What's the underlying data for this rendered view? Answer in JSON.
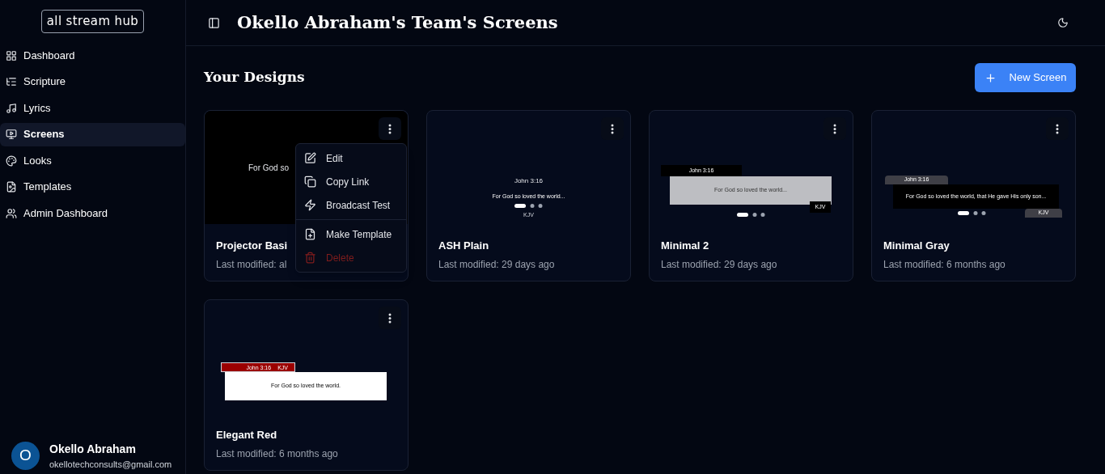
{
  "sidebar": {
    "logo": "all stream hub",
    "items": [
      {
        "label": "Dashboard",
        "selected": false
      },
      {
        "label": "Scripture",
        "selected": false
      },
      {
        "label": "Lyrics",
        "selected": false
      },
      {
        "label": "Screens",
        "selected": true
      },
      {
        "label": "Looks",
        "selected": false
      },
      {
        "label": "Templates",
        "selected": false
      },
      {
        "label": "Admin Dashboard",
        "selected": false
      }
    ],
    "user": {
      "initial": "O",
      "name": "Okello Abraham",
      "email": "okellotechconsults@gmail.com"
    }
  },
  "header": {
    "title": "Okello Abraham's Team's Screens"
  },
  "section": {
    "title": "Your Designs",
    "new_button": "New Screen"
  },
  "cards": [
    {
      "name": "Projector Basi",
      "modified": "Last modified: al",
      "preview": {
        "kind": "blank",
        "text": "For God so"
      },
      "menu": {
        "items": [
          {
            "label": "Edit",
            "kind": "normal"
          },
          {
            "label": "Copy Link",
            "kind": "normal"
          },
          {
            "label": "Broadcast Test",
            "kind": "normal"
          },
          {
            "label": "Make Template",
            "kind": "normal"
          },
          {
            "label": "Delete",
            "kind": "danger"
          }
        ]
      }
    },
    {
      "name": "ASH Plain",
      "modified": "Last modified: 29 days ago",
      "preview": {
        "kind": "plain",
        "reference": "John 3:16",
        "text": "For God so loved the world...",
        "version": "KJV"
      }
    },
    {
      "name": "Minimal 2",
      "modified": "Last modified: 29 days ago",
      "preview": {
        "kind": "minimal",
        "reference": "John 3:16",
        "text": "For God so loved the world...",
        "version": "KJV"
      }
    },
    {
      "name": "Minimal Gray",
      "modified": "Last modified: 6 months ago",
      "preview": {
        "kind": "gray",
        "reference": "John 3:16",
        "text": "For God so loved the world, that He gave His only son...",
        "version": "KJV"
      }
    },
    {
      "name": "Elegant Red",
      "modified": "Last modified: 6 months ago",
      "preview": {
        "kind": "elegant",
        "reference": "John 3:16",
        "text": "For God so loved the world.",
        "version": "KJV"
      }
    }
  ]
}
